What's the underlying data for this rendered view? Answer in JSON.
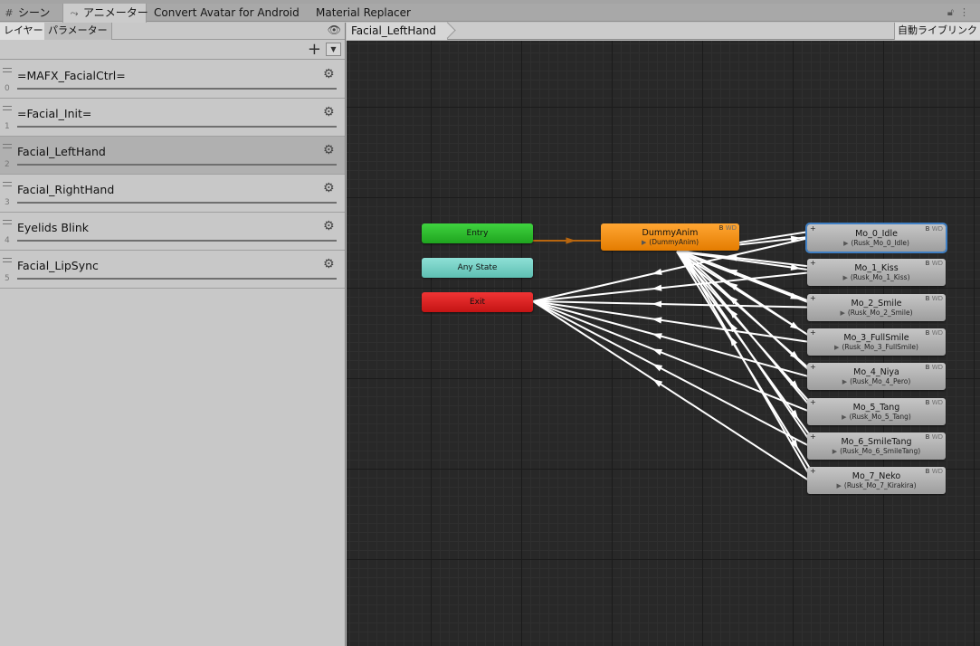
{
  "window_tabs": [
    {
      "label": "シーン",
      "icon": "grid-icon"
    },
    {
      "label": "アニメーター",
      "icon": "animator-icon"
    },
    {
      "label": "Convert Avatar for Android"
    },
    {
      "label": "Material Replacer"
    }
  ],
  "left_panel": {
    "tabs": [
      "レイヤー",
      "パラメーター"
    ],
    "layers": [
      {
        "name": "=MAFX_FacialCtrl=",
        "index": "0"
      },
      {
        "name": "=Facial_Init=",
        "index": "1"
      },
      {
        "name": "Facial_LeftHand",
        "index": "2",
        "selected": true
      },
      {
        "name": "Facial_RightHand",
        "index": "3"
      },
      {
        "name": "Eyelids Blink",
        "index": "4"
      },
      {
        "name": "Facial_LipSync",
        "index": "5"
      }
    ]
  },
  "graph": {
    "breadcrumb": "Facial_LeftHand",
    "auto_live_link": "自動ライブリンク",
    "special_nodes": {
      "entry": "Entry",
      "any_state": "Any State",
      "exit": "Exit"
    },
    "default_state": {
      "name": "DummyAnim",
      "motion": "(DummyAnim)"
    },
    "flag_b": "B",
    "flag_wd": "WD",
    "states": [
      {
        "name": "Mo_0_Idle",
        "motion": "(Rusk_Mo_0_Idle)"
      },
      {
        "name": "Mo_1_Kiss",
        "motion": "(Rusk_Mo_1_Kiss)"
      },
      {
        "name": "Mo_2_Smile",
        "motion": "(Rusk_Mo_2_Smile)"
      },
      {
        "name": "Mo_3_FullSmile",
        "motion": "(Rusk_Mo_3_FullSmile)"
      },
      {
        "name": "Mo_4_Niya",
        "motion": "(Rusk_Mo_4_Pero)"
      },
      {
        "name": "Mo_5_Tang",
        "motion": "(Rusk_Mo_5_Tang)"
      },
      {
        "name": "Mo_6_SmileTang",
        "motion": "(Rusk_Mo_6_SmileTang)"
      },
      {
        "name": "Mo_7_Neko",
        "motion": "(Rusk_Mo_7_Kirakira)"
      }
    ],
    "colors": {
      "entry": "#2fbf2f",
      "any_state": "#76d2c6",
      "exit": "#d92020",
      "default_state": "#f08d10",
      "state": "#b4b4b4",
      "selection": "#3f7fc4",
      "transition": "#ffffff",
      "entry_transition": "#b8660f"
    }
  }
}
